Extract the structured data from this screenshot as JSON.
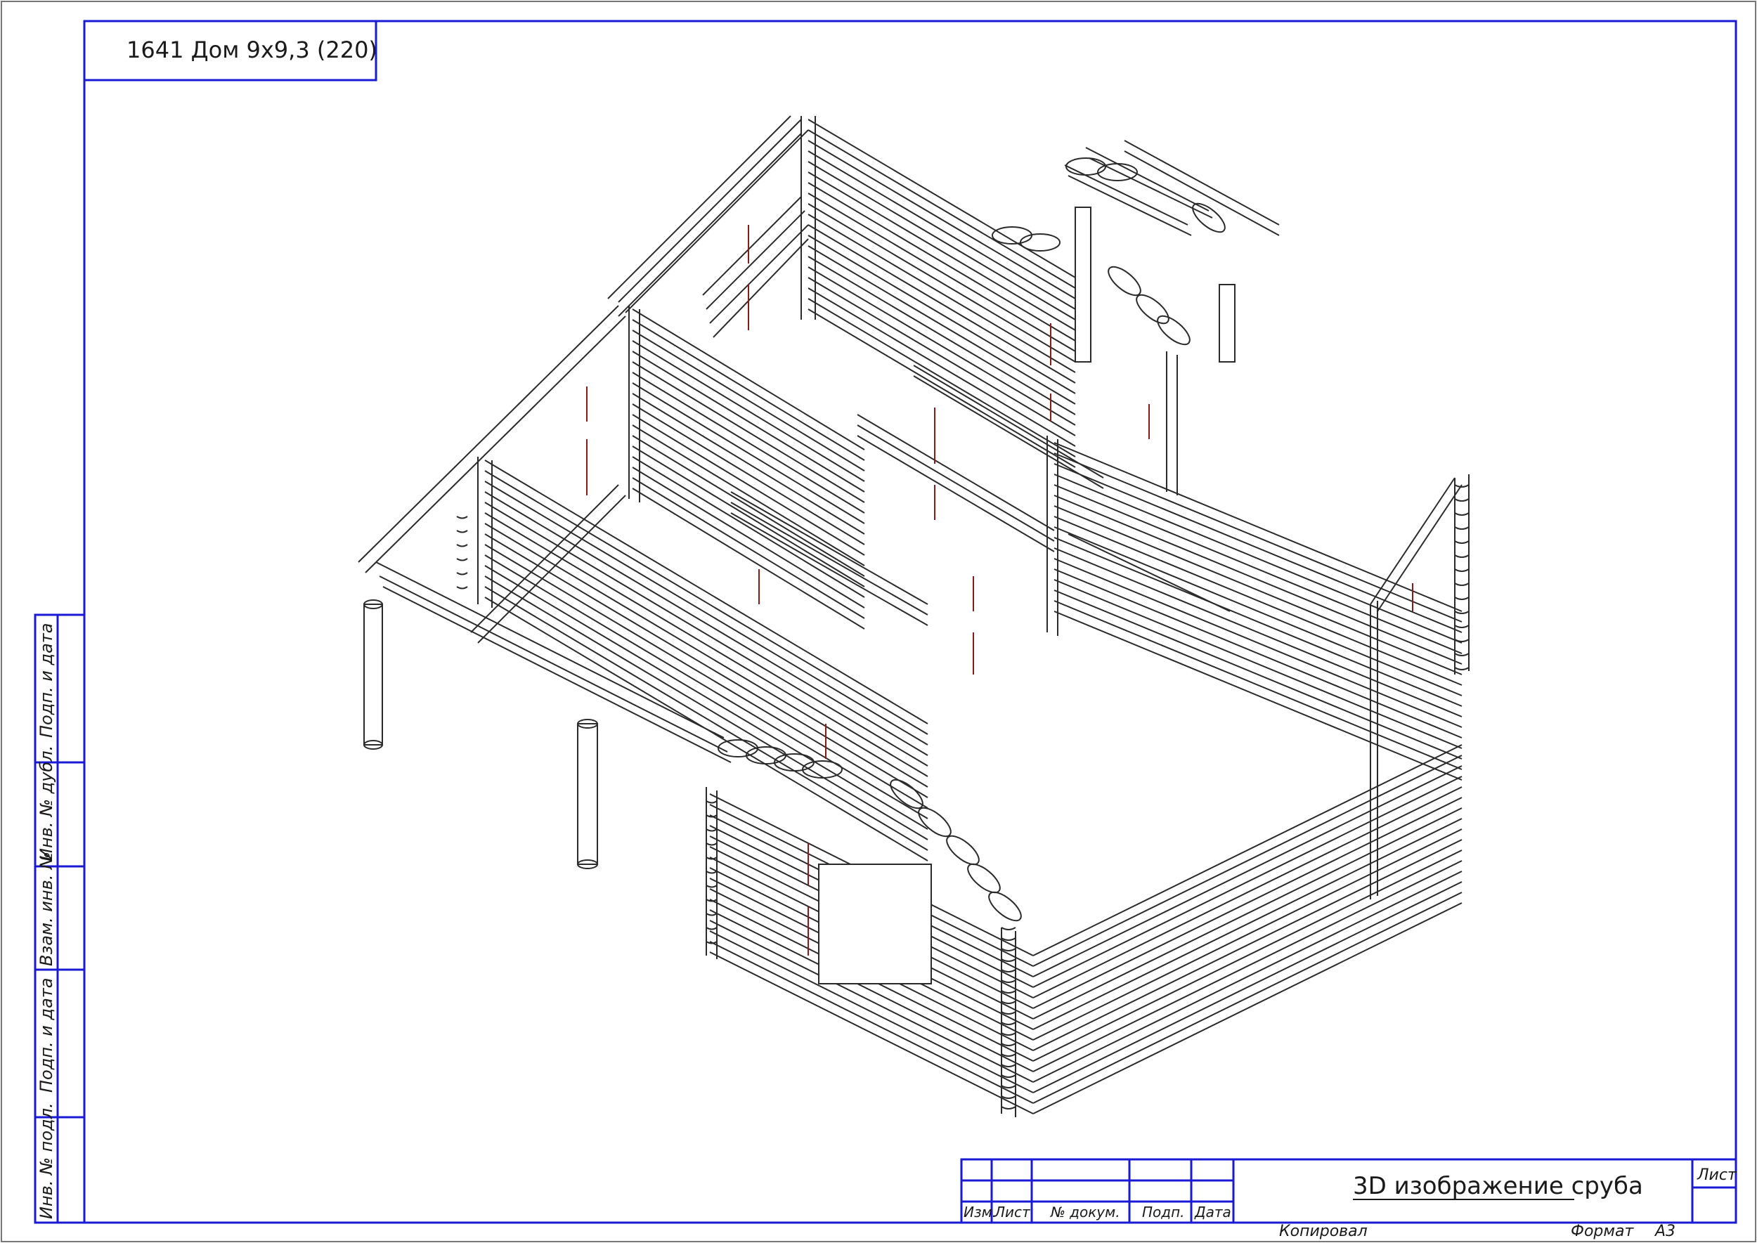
{
  "project_title": "1641 Дом 9х9,3 (220)",
  "drawing_title": "3D изображение сруба",
  "stamp": {
    "izm": "Изм.",
    "list": "Лист",
    "n_dokum": "№ докум.",
    "podp": "Подп.",
    "data": "Дата",
    "sheet_label": "Лист"
  },
  "side_fields": {
    "podp_i_data_top": "Подп. и дата",
    "inv_n_dubl": "Инв. № дубл.",
    "vzam_inv_n": "Взам. инв. №",
    "podp_i_data_bottom": "Подп. и дата",
    "inv_n_podl": "Инв. № подл."
  },
  "footer": {
    "copied": "Копировал",
    "format_label": "Формат",
    "format_value": "А3"
  },
  "colors": {
    "frame": "#1a1ad6",
    "drawing": "#2a2a2a",
    "accent": "#8b1a1a"
  }
}
